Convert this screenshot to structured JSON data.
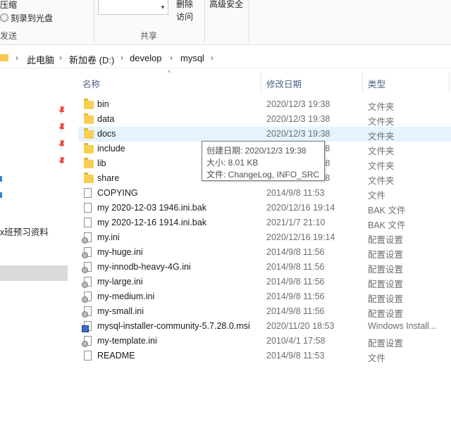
{
  "ribbon": {
    "compress_label": "压缩",
    "burn_label": "刻录到光盘",
    "send_group_label": "发送",
    "delete_label_line1": "删除",
    "access_label_line1": "访问",
    "advanced_security_label": "高级安全",
    "share_group_label": "共享",
    "dropdown_arrow": "▾"
  },
  "address": {
    "chevron": "›",
    "segments": [
      "此电脑",
      "新加卷 (D:)",
      "develop",
      "mysql"
    ]
  },
  "nav": {
    "partial_item_label": "x班预习资料",
    "pin_glyph": "📌"
  },
  "columns": {
    "name": "名称",
    "date": "修改日期",
    "type": "类型",
    "sort_caret": "^"
  },
  "files": [
    {
      "icon": "folder",
      "name": "bin",
      "date": "2020/12/3 19:38",
      "type": "文件夹"
    },
    {
      "icon": "folder",
      "name": "data",
      "date": "2020/12/3 19:38",
      "type": "文件夹"
    },
    {
      "icon": "folder",
      "name": "docs",
      "date": "2020/12/3 19:38",
      "type": "文件夹"
    },
    {
      "icon": "folder",
      "name": "include",
      "date": "2020/12/3 19:38",
      "type": "文件夹"
    },
    {
      "icon": "folder",
      "name": "lib",
      "date": "2020/12/3 19:38",
      "type": "文件夹"
    },
    {
      "icon": "folder",
      "name": "share",
      "date": "2020/12/3 19:38",
      "type": "文件夹"
    },
    {
      "icon": "file",
      "name": "COPYING",
      "date": "2014/9/8 11:53",
      "type": "文件"
    },
    {
      "icon": "file",
      "name": "my 2020-12-03 1946.ini.bak",
      "date": "2020/12/16 19:14",
      "type": "BAK 文件"
    },
    {
      "icon": "file",
      "name": "my 2020-12-16 1914.ini.bak",
      "date": "2021/1/7 21:10",
      "type": "BAK 文件"
    },
    {
      "icon": "ini",
      "name": "my.ini",
      "date": "2020/12/16 19:14",
      "type": "配置设置"
    },
    {
      "icon": "ini",
      "name": "my-huge.ini",
      "date": "2014/9/8 11:56",
      "type": "配置设置"
    },
    {
      "icon": "ini",
      "name": "my-innodb-heavy-4G.ini",
      "date": "2014/9/8 11:56",
      "type": "配置设置"
    },
    {
      "icon": "ini",
      "name": "my-large.ini",
      "date": "2014/9/8 11:56",
      "type": "配置设置"
    },
    {
      "icon": "ini",
      "name": "my-medium.ini",
      "date": "2014/9/8 11:56",
      "type": "配置设置"
    },
    {
      "icon": "ini",
      "name": "my-small.ini",
      "date": "2014/9/8 11:56",
      "type": "配置设置"
    },
    {
      "icon": "msi",
      "name": "mysql-installer-community-5.7.28.0.msi",
      "date": "2020/11/20 18:53",
      "type": "Windows Install..."
    },
    {
      "icon": "ini",
      "name": "my-template.ini",
      "date": "2010/4/1 17:58",
      "type": "配置设置"
    },
    {
      "icon": "file",
      "name": "README",
      "date": "2014/9/8 11:53",
      "type": "文件"
    }
  ],
  "hovered_row_name": "docs",
  "tooltip": {
    "created": "创建日期: 2020/12/3 19:38",
    "size": "大小: 8.01 KB",
    "files": "文件: ChangeLog, INFO_SRC"
  },
  "colors": {
    "folder": "#f8cf52",
    "hover": "#e5f3ff",
    "header_text": "#4d6082",
    "nav_selected": "#d9d9d9"
  }
}
